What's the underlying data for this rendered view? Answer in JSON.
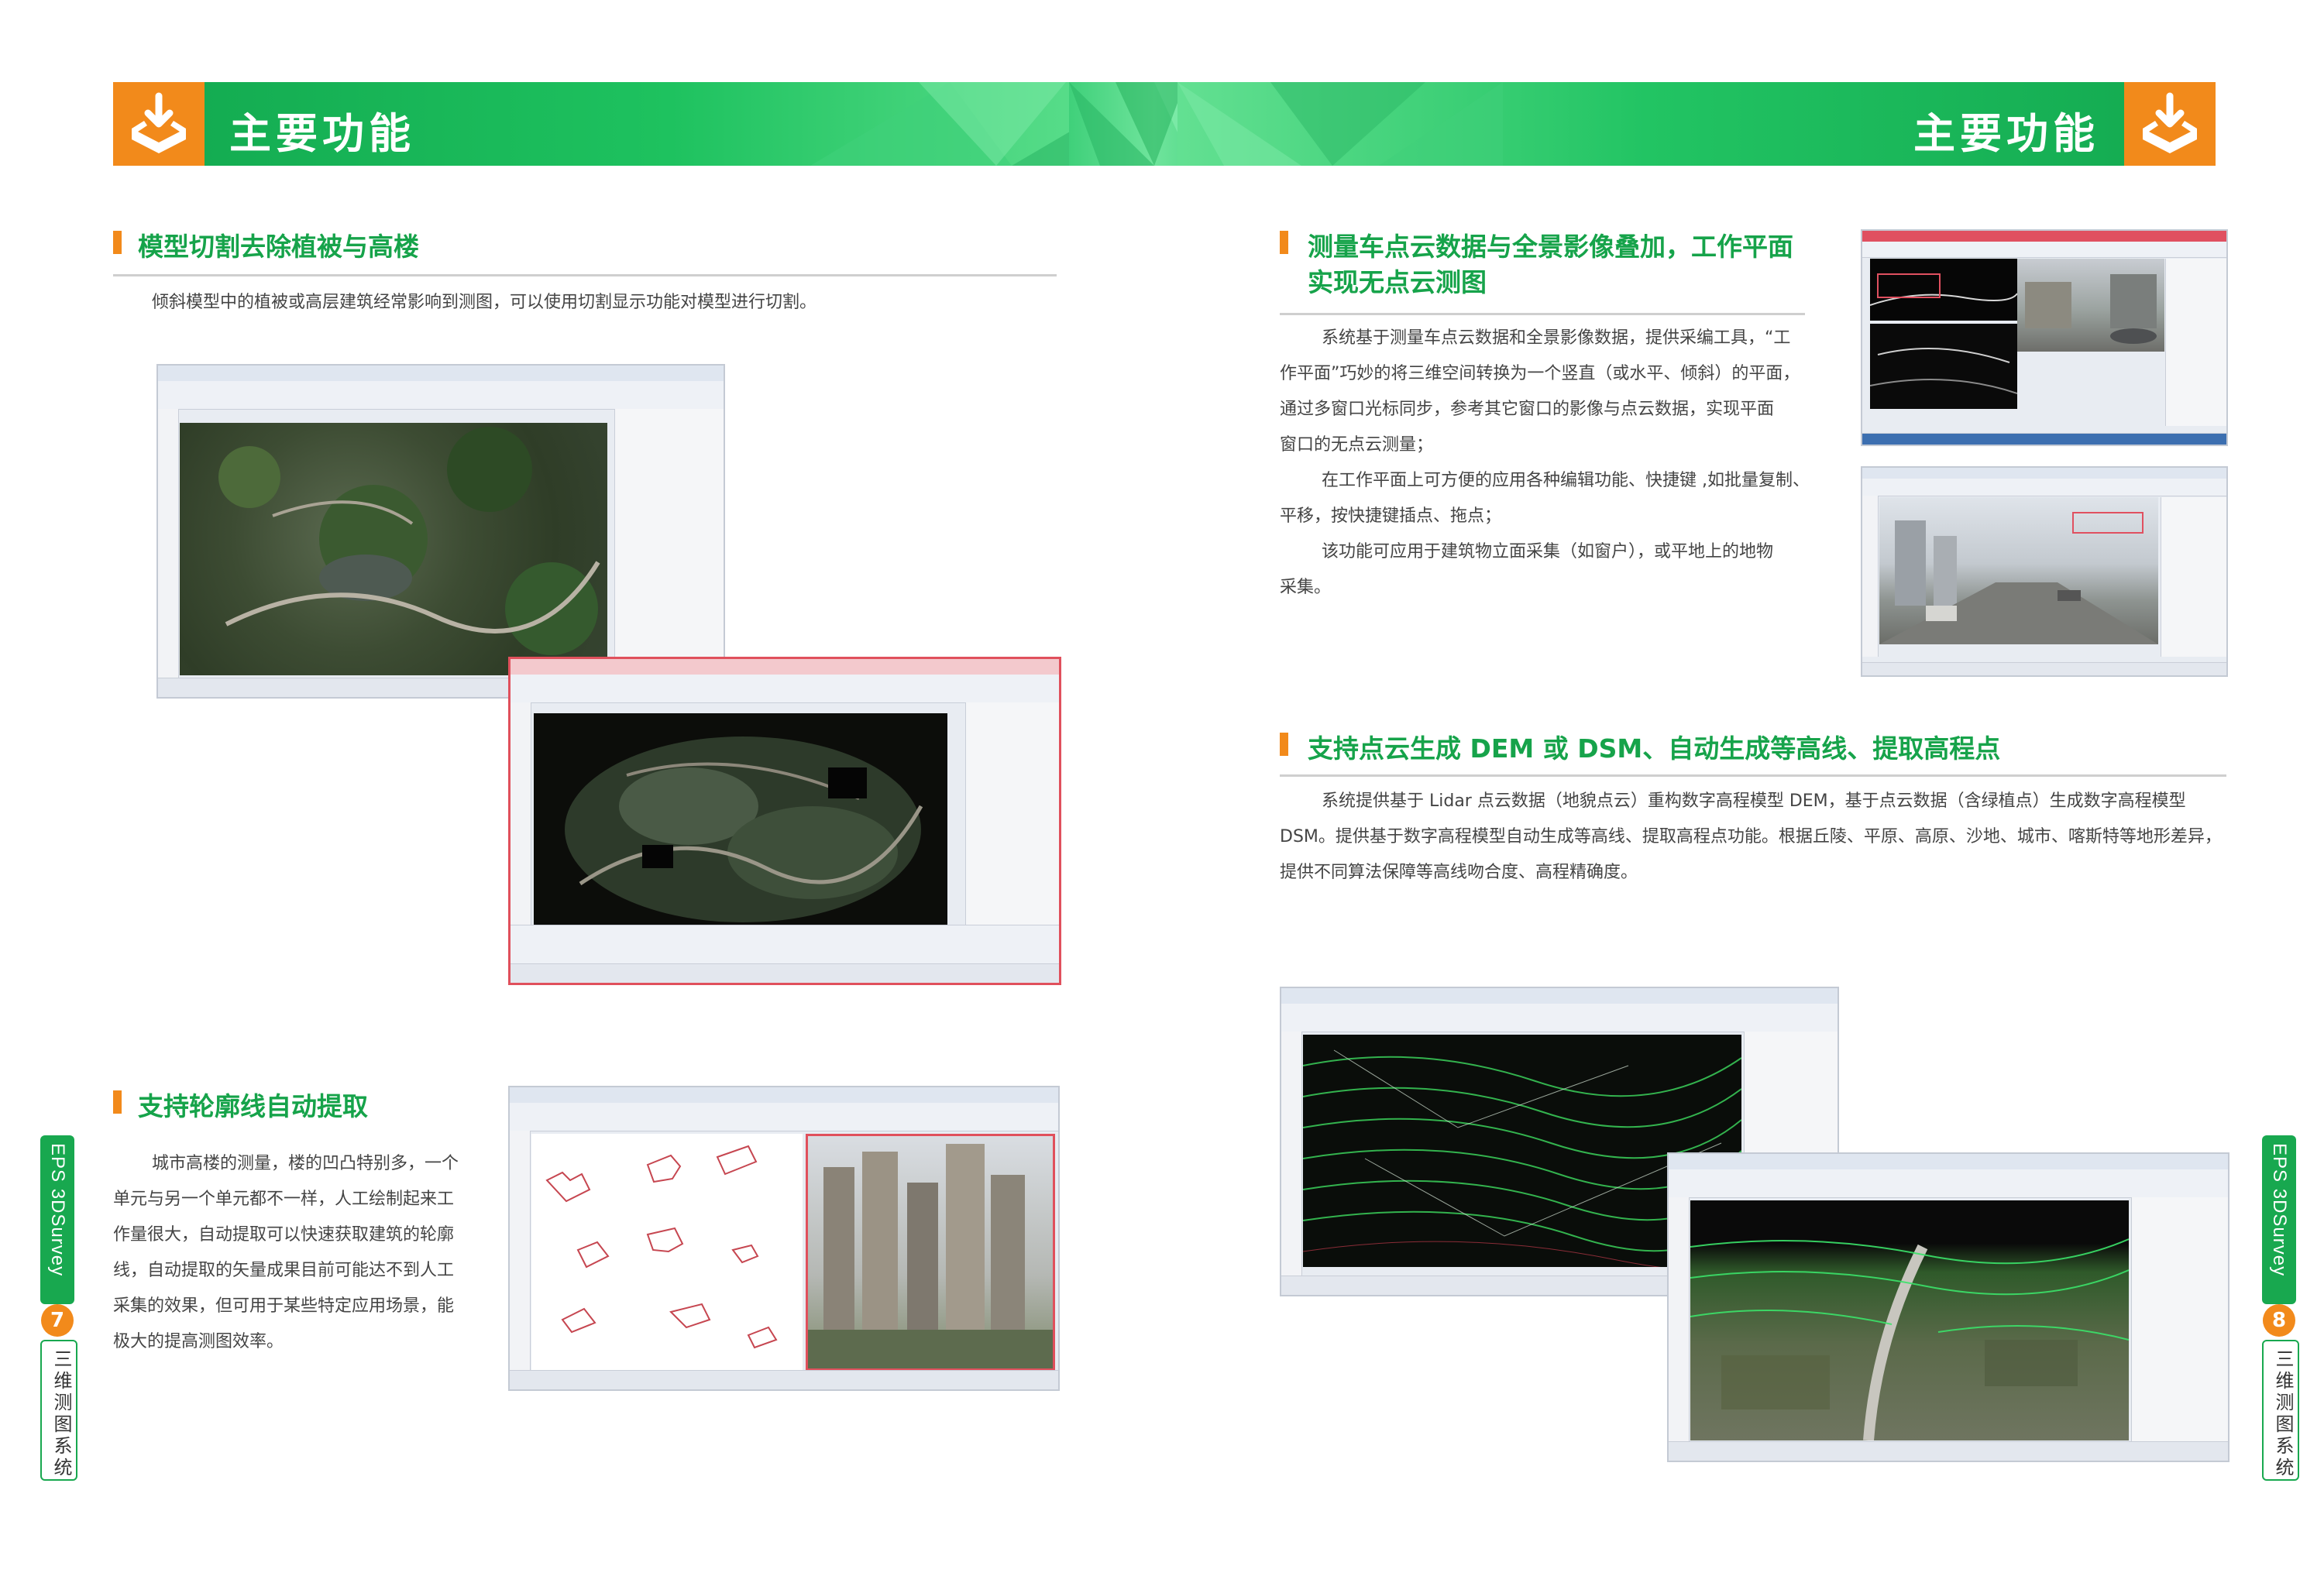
{
  "header": {
    "left_title": "主要功能",
    "right_title": "主要功能"
  },
  "colors": {
    "green": "#16a34a",
    "orange": "#f28a1b",
    "banner_green": "#1ec25f"
  },
  "icons": {
    "header_icon": "download-tray-icon"
  },
  "left_page": {
    "section1": {
      "title": "模型切割去除植被与高楼",
      "text": "倾斜模型中的植被或高层建筑经常影响到测图，可以使用切割显示功能对模型进行切割。"
    },
    "section2": {
      "title": "支持轮廓线自动提取",
      "lines": [
        "城市高楼的测量，楼的凹凸特别多，一个",
        "单元与另一个单元都不一样，人工绘制起来工",
        "作量很大，自动提取可以快速获取建筑的轮廓",
        "线，自动提取的矢量成果目前可能达不到人工",
        "采集的效果，但可用于某些特定应用场景，能",
        "极大的提高测图效率。"
      ]
    },
    "side_tab": {
      "brand": "EPS 3DSurvey",
      "page": "7",
      "subtitle": "三维测图系统"
    }
  },
  "right_page": {
    "section1": {
      "title_line1": "测量车点云数据与全景影像叠加，工作平面",
      "title_line2": "实现无点云测图",
      "lines": [
        "系统基于测量车点云数据和全景影像数据，提供采编工具，“工",
        "作平面”巧妙的将三维空间转换为一个竖直（或水平、倾斜）的平面，",
        "通过多窗口光标同步，参考其它窗口的影像与点云数据，实现平面",
        "窗口的无点云测量；",
        "在工作平面上可方便的应用各种编辑功能、快捷键 ,如批量复制、",
        "平移，按快捷键插点、拖点；",
        "该功能可应用于建筑物立面采集（如窗户），或平地上的地物",
        "采集。"
      ]
    },
    "section2": {
      "title": "支持点云生成 DEM 或 DSM、自动生成等高线、提取高程点",
      "lines": [
        "系统提供基于 Lidar 点云数据（地貌点云）重构数字高程模型 DEM，基于点云数据（含绿植点）生成数字高程模型",
        "DSM。提供基于数字高程模型自动生成等高线、提取高程点功能。根据丘陵、平原、高原、沙地、城市、喀斯特等地形差异，",
        "提供不同算法保障等高线吻合度、高程精确度。"
      ]
    },
    "side_tab": {
      "brand": "EPS 3DSurvey",
      "page": "8",
      "subtitle": "三维测图系统"
    }
  }
}
